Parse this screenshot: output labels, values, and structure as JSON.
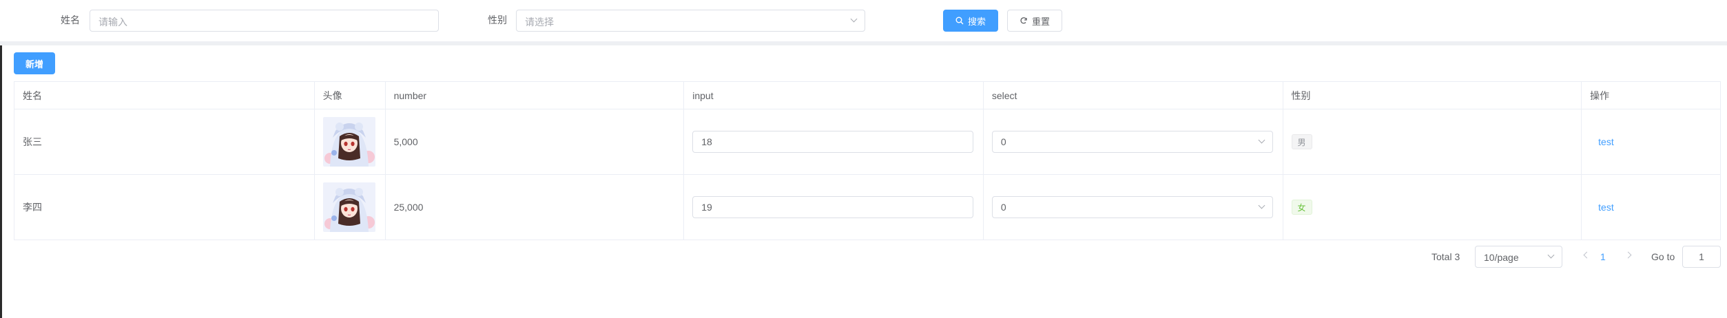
{
  "search": {
    "name_label": "姓名",
    "name_placeholder": "请输入",
    "gender_label": "性别",
    "gender_placeholder": "请选择",
    "search_button": "搜索",
    "reset_button": "重置"
  },
  "toolbar": {
    "add_button": "新增"
  },
  "table": {
    "columns": [
      "姓名",
      "头像",
      "number",
      "input",
      "select",
      "性别",
      "操作"
    ],
    "rows": [
      {
        "name": "张三",
        "number": "5,000",
        "input": "18",
        "select": "0",
        "gender": "男",
        "action": "test"
      },
      {
        "name": "李四",
        "number": "25,000",
        "input": "19",
        "select": "0",
        "gender": "女",
        "action": "test"
      }
    ]
  },
  "pagination": {
    "total": "Total 3",
    "page_size": "10/page",
    "current_page": "1",
    "goto_label": "Go to",
    "goto_value": "1"
  },
  "colors": {
    "primary": "#409eff",
    "success": "#67c23a",
    "border": "#dcdfe6"
  },
  "icons": {
    "search_button": "search-icon",
    "reset_button": "refresh-icon",
    "select_arrow": "chevron-down-icon"
  }
}
